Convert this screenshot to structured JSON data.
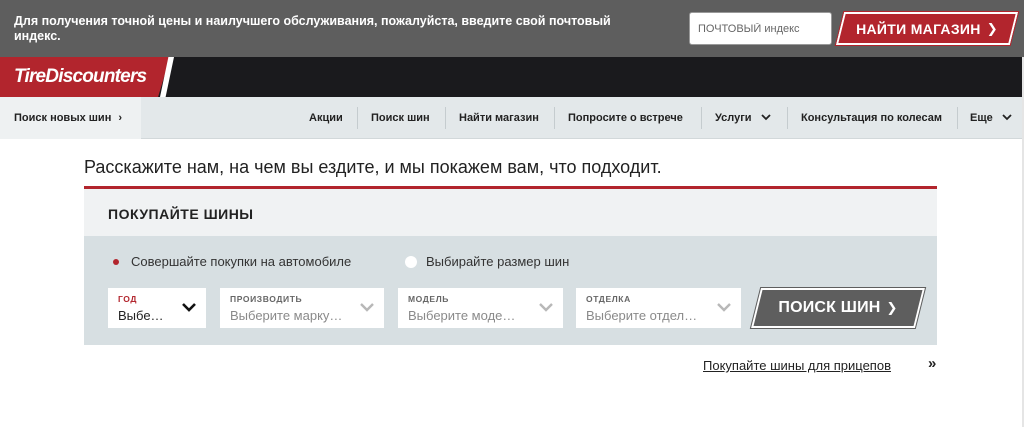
{
  "topbar": {
    "message": "Для получения точной цены и наилучшего обслуживания, пожалуйста, введите свой почтовый индекс.",
    "zip_placeholder": "ПОЧТОВЫЙ индекс",
    "find_store_label": "НАЙТИ МАГАЗИН",
    "find_store_arrow": "❯"
  },
  "brand": {
    "logo_text": "TireDiscounters",
    "accent_color": "#b2252d"
  },
  "nav": {
    "first": {
      "label": "Поиск новых шин",
      "icon": "chevron-right-icon",
      "glyph": "›"
    },
    "items": [
      {
        "label": "Акции"
      },
      {
        "label": "Поиск шин"
      },
      {
        "label": "Найти магазин"
      },
      {
        "label": "Попросите о встрече"
      },
      {
        "label": "Услуги",
        "caret": "⌄"
      },
      {
        "label": "Консультация по колесам"
      },
      {
        "label": "Еще",
        "caret": "⌄"
      }
    ]
  },
  "main": {
    "headline": "Расскажите нам, на чем вы ездите, и мы покажем вам, что подходит.",
    "panel_title": "ПОКУПАЙТЕ ШИНЫ",
    "radios": [
      {
        "label": "Совершайте покупки на автомобиле",
        "selected": true
      },
      {
        "label": "Выбирайте размер шин",
        "selected": false
      }
    ],
    "selects": [
      {
        "caption": "ГОД",
        "value": "Выбе…"
      },
      {
        "caption": "ПРОИЗВОДИТЬ",
        "value": "Выберите марку…"
      },
      {
        "caption": "МОДЕЛЬ",
        "value": "Выберите моде…"
      },
      {
        "caption": "ОТДЕЛКА",
        "value": "Выберите отдел…"
      }
    ],
    "search_label": "ПОИСК ШИН",
    "search_arrow": "❯",
    "trailer_link": "Покупайте шины для прицепов",
    "trailer_arrow": "»"
  }
}
